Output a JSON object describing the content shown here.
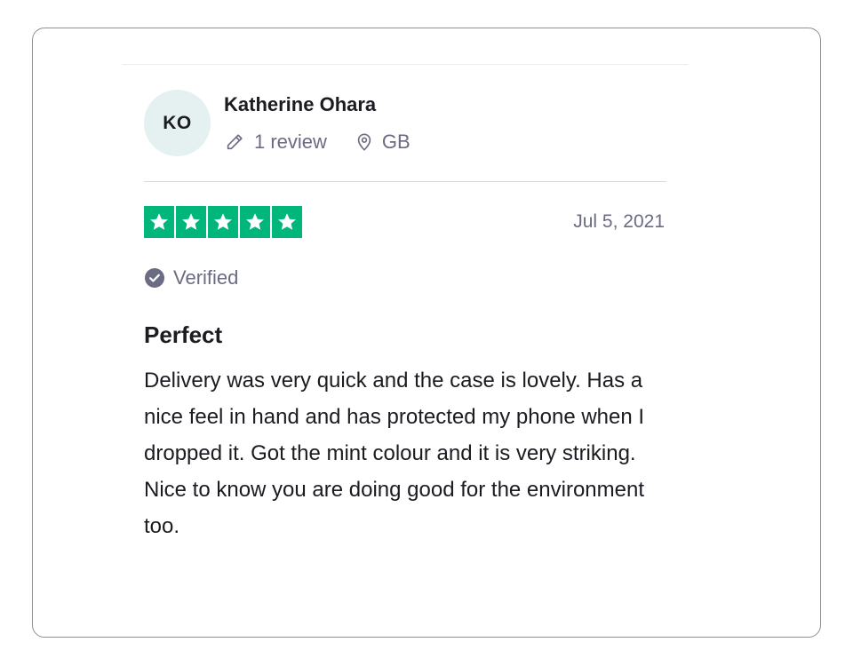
{
  "reviewer": {
    "initials": "KO",
    "name": "Katherine Ohara",
    "review_count": "1 review",
    "country": "GB"
  },
  "rating": {
    "stars": 5,
    "max": 5,
    "star_color": "#00b67a"
  },
  "date": "Jul 5, 2021",
  "verified_label": "Verified",
  "review": {
    "title": "Perfect",
    "body": "Delivery was very quick and the case is lovely. Has a nice feel in hand and has protected my phone when I dropped it. Got the mint colour and it is very striking. Nice to know you are doing good for the environment too."
  },
  "icons": {
    "review_count": "pencil-icon",
    "country": "location-pin-icon",
    "verified": "check-circle-icon",
    "rating": "star-icon"
  },
  "colors": {
    "avatar_bg": "#e4f1f0",
    "text_primary": "#1b1b21",
    "text_secondary": "#6b6b83"
  }
}
